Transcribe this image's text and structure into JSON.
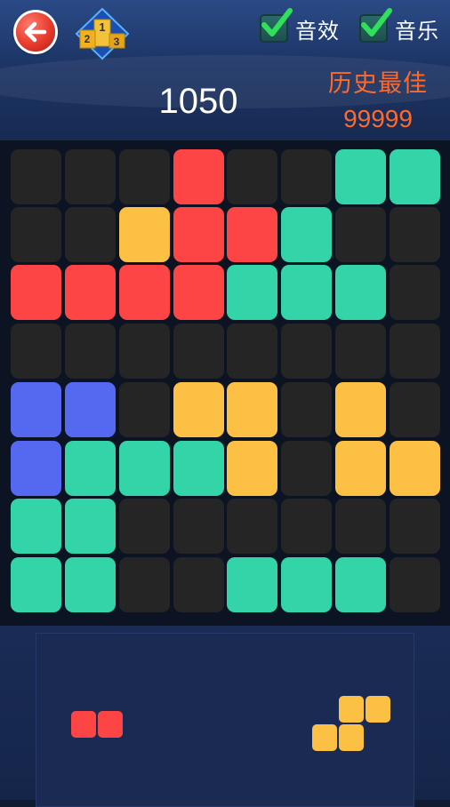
{
  "header": {
    "back_icon": "back-arrow-icon",
    "leaderboard_icon": "podium-icon",
    "leaderboard_digits": [
      "1",
      "2",
      "3"
    ],
    "sound_label": "音效",
    "sound_checked": true,
    "music_label": "音乐",
    "music_checked": true,
    "score": "1050",
    "best_title": "历史最佳",
    "best_value": "99999"
  },
  "colors": {
    "red": "#fd4545",
    "green": "#34d4a9",
    "yellow": "#fcc144",
    "blue": "#5468f0",
    "empty": "#252525",
    "best_text": "#ff6a2a"
  },
  "board": {
    "rows": 8,
    "cols": 8,
    "cells": [
      [
        "empty",
        "empty",
        "empty",
        "red",
        "empty",
        "empty",
        "green",
        "green"
      ],
      [
        "empty",
        "empty",
        "yellow",
        "red",
        "red",
        "green",
        "empty",
        "empty"
      ],
      [
        "red",
        "red",
        "red",
        "red",
        "green",
        "green",
        "green",
        "empty"
      ],
      [
        "empty",
        "empty",
        "empty",
        "empty",
        "empty",
        "empty",
        "empty",
        "empty"
      ],
      [
        "blue",
        "blue",
        "empty",
        "yellow",
        "yellow",
        "empty",
        "yellow",
        "empty"
      ],
      [
        "blue",
        "green",
        "green",
        "green",
        "yellow",
        "empty",
        "yellow",
        "yellow"
      ],
      [
        "green",
        "green",
        "empty",
        "empty",
        "empty",
        "empty",
        "empty",
        "empty"
      ],
      [
        "green",
        "green",
        "empty",
        "empty",
        "green",
        "green",
        "green",
        "empty"
      ]
    ]
  },
  "tray": {
    "pieces": [
      {
        "color": "red",
        "shape": "horizontal-domino",
        "cells": [
          [
            0,
            0
          ],
          [
            0,
            1
          ]
        ]
      },
      {
        "color": "yellow",
        "shape": "s-tetromino",
        "cells": [
          [
            0,
            1
          ],
          [
            0,
            2
          ],
          [
            1,
            0
          ],
          [
            1,
            1
          ]
        ]
      }
    ]
  }
}
